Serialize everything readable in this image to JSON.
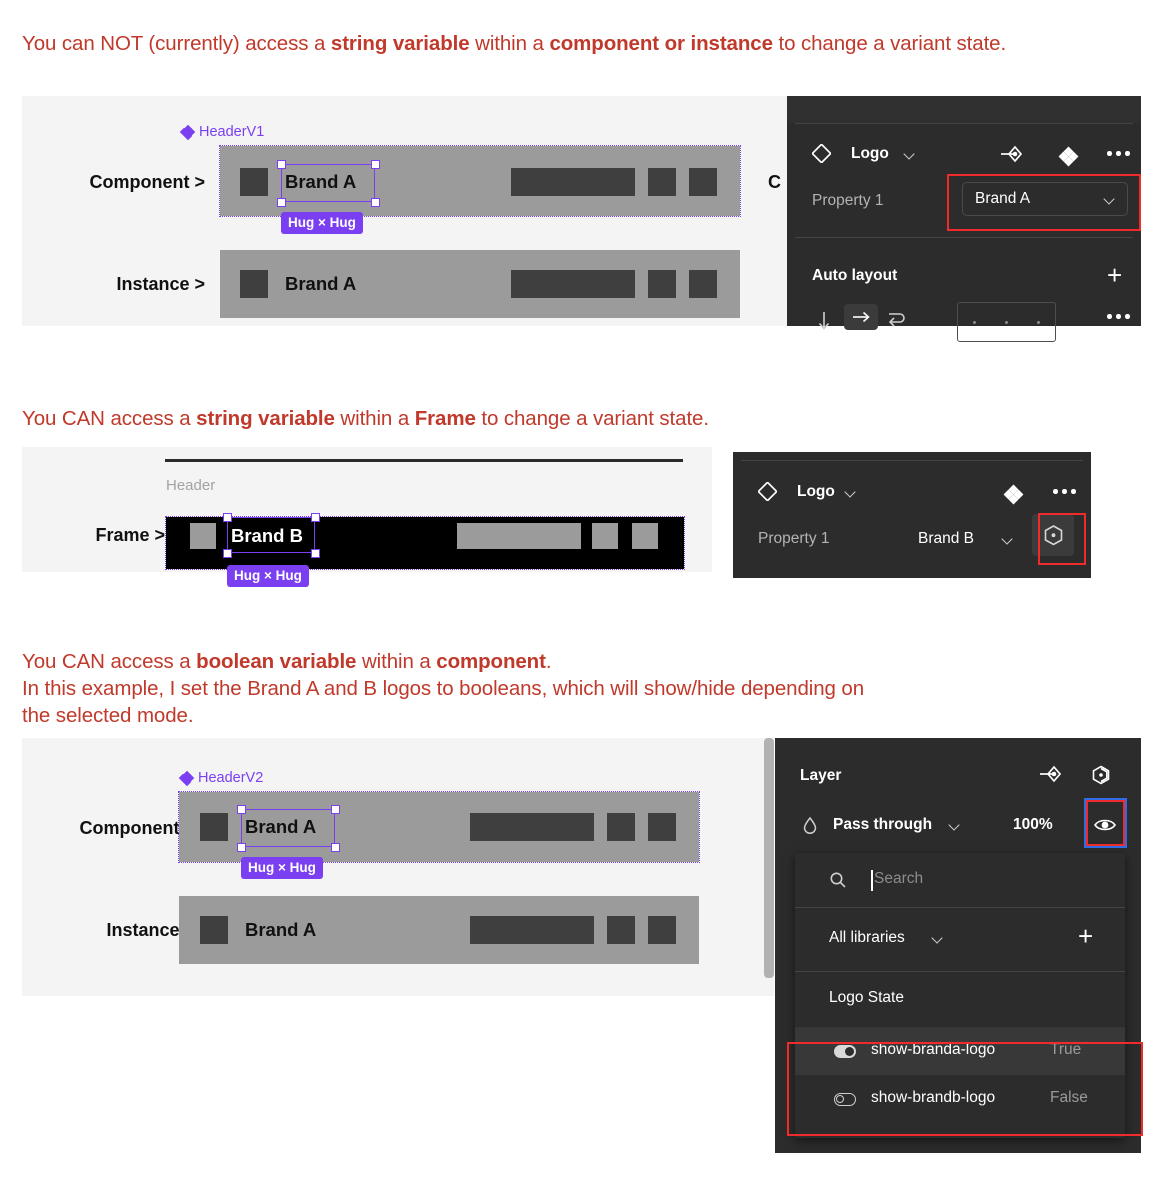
{
  "sections": [
    {
      "heading_parts": [
        {
          "t": "You can NOT (currently) access a ",
          "b": false
        },
        {
          "t": "string variable",
          "b": true
        },
        {
          "t": " within a ",
          "b": false
        },
        {
          "t": "component or instance",
          "b": true
        },
        {
          "t": " to change a variant state.",
          "b": false
        }
      ],
      "labels": {
        "component": "Component >",
        "instance": "Instance >"
      },
      "component_name": "HeaderV1",
      "brand_component": "Brand A",
      "brand_instance": "Brand A",
      "hug_tag": "Hug × Hug",
      "panel": {
        "title": "Logo",
        "property_label": "Property 1",
        "property_value": "Brand A",
        "auto_layout_label": "Auto layout",
        "clipped_text": "C"
      }
    },
    {
      "heading_parts": [
        {
          "t": "You CAN access a ",
          "b": false
        },
        {
          "t": "string variable",
          "b": true
        },
        {
          "t": " within a ",
          "b": false
        },
        {
          "t": "Frame",
          "b": true
        },
        {
          "t": " to change a variant state.",
          "b": false
        }
      ],
      "labels": {
        "frame": "Frame >"
      },
      "frame_name": "Header",
      "brand": "Brand B",
      "hug_tag": "Hug × Hug",
      "panel": {
        "title": "Logo",
        "property_label": "Property 1",
        "property_value": "Brand B"
      }
    },
    {
      "heading_parts_line1": [
        {
          "t": "You CAN access a ",
          "b": false
        },
        {
          "t": "boolean variable",
          "b": true
        },
        {
          "t": " within a ",
          "b": false
        },
        {
          "t": "component",
          "b": true
        },
        {
          "t": ".",
          "b": false
        }
      ],
      "heading_line2": "In this example, I set the Brand A and B logos to booleans, which will show/hide depending on",
      "heading_line3": "the selected mode.",
      "labels": {
        "component": "Component >",
        "instance": "Instance >"
      },
      "component_name": "HeaderV2",
      "brand_component": "Brand A",
      "brand_instance": "Brand A",
      "hug_tag": "Hug × Hug",
      "panel": {
        "title": "Layer",
        "blend_mode": "Pass through",
        "opacity": "100%"
      },
      "dropdown": {
        "search_placeholder": "Search",
        "library_filter": "All libraries",
        "group_title": "Logo State",
        "items": [
          {
            "name": "show-branda-logo",
            "value": "True",
            "on": true
          },
          {
            "name": "show-brandb-logo",
            "value": "False",
            "on": false
          }
        ]
      }
    }
  ],
  "colors": {
    "heading_red": "#c0392b",
    "accent_purple": "#7b3ff2",
    "highlight_red": "#ef2b2b",
    "highlight_blue": "#2f6ce5",
    "panel_bg": "#2c2c2c"
  },
  "icons": {
    "component_diamond": "component-diamond-icon",
    "swap_instance": "swap-instance-icon",
    "variants": "variants-icon",
    "more": "more-options-icon",
    "plus": "plus-icon",
    "chevron_down": "chevron-down-icon",
    "variable_hex": "variable-hexagon-icon",
    "eye": "eye-visible-icon",
    "search": "search-icon",
    "blend_drop": "blend-mode-drop-icon",
    "arrow_down": "arrow-down-icon",
    "arrow_right": "arrow-right-icon",
    "wrap": "wrap-icon"
  }
}
